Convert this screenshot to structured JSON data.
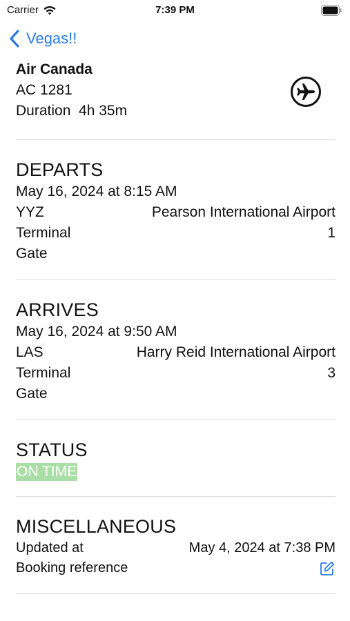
{
  "status_bar": {
    "carrier": "Carrier",
    "time": "7:39 PM"
  },
  "nav": {
    "back_label": "Vegas!!"
  },
  "flight": {
    "airline": "Air Canada",
    "number": "AC 1281",
    "duration_label": "Duration",
    "duration_value": "4h 35m"
  },
  "departs": {
    "title": "DEPARTS",
    "datetime": "May 16, 2024 at 8:15 AM",
    "code": "YYZ",
    "airport": "Pearson International Airport",
    "terminal_label": "Terminal",
    "terminal_value": "1",
    "gate_label": "Gate"
  },
  "arrives": {
    "title": "ARRIVES",
    "datetime": "May 16, 2024 at 9:50 AM",
    "code": "LAS",
    "airport": "Harry Reid International Airport",
    "terminal_label": "Terminal",
    "terminal_value": "3",
    "gate_label": "Gate"
  },
  "status": {
    "title": "STATUS",
    "value": "ON TIME",
    "badge_color": "#a9dfa6"
  },
  "misc": {
    "title": "MISCELLANEOUS",
    "updated_label": "Updated at",
    "updated_value": "May 4, 2024 at 7:38 PM",
    "booking_label": "Booking reference"
  },
  "colors": {
    "accent": "#2a7ae2",
    "divider": "#dcdcdc"
  },
  "icons": {
    "wifi": "wifi-icon",
    "battery": "battery-icon",
    "back": "chevron-left-icon",
    "airplane": "airplane-icon",
    "edit": "edit-icon"
  }
}
